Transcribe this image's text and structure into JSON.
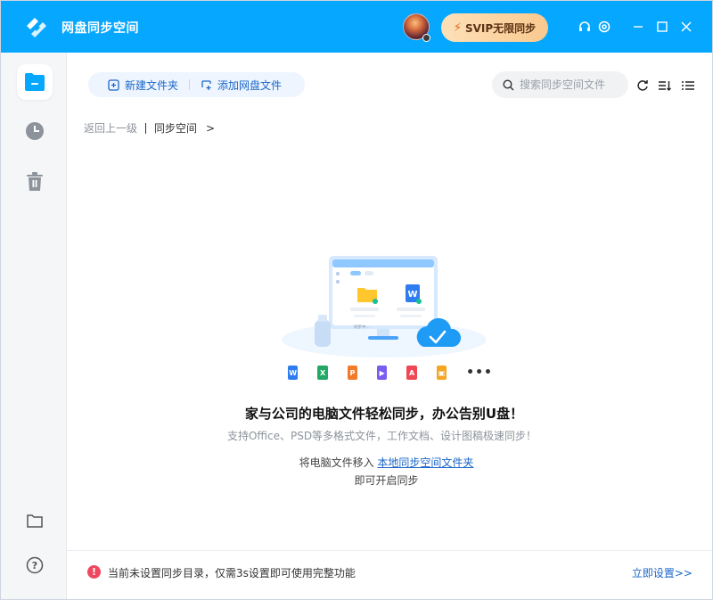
{
  "app": {
    "title": "网盘同步空间"
  },
  "header": {
    "svip_label": "SVIP无限同步"
  },
  "toolbar": {
    "new_folder": "新建文件夹",
    "add_cloud_file": "添加网盘文件",
    "search_placeholder": "搜索同步空间文件"
  },
  "breadcrumb": {
    "back": "返回上一级",
    "current": "同步空间",
    "chevron": ">"
  },
  "empty_state": {
    "illustration_caption": "同步中...",
    "file_types": [
      {
        "name": "word-icon",
        "color": "#2f7cf0",
        "letter": "W"
      },
      {
        "name": "excel-icon",
        "color": "#23a866",
        "letter": "X"
      },
      {
        "name": "ppt-icon",
        "color": "#f27b2b",
        "letter": "P"
      },
      {
        "name": "video-icon",
        "color": "#7a5cf0",
        "letter": "▶"
      },
      {
        "name": "pdf-icon",
        "color": "#ef4754",
        "letter": "A"
      },
      {
        "name": "image-icon",
        "color": "#f5a623",
        "letter": "▣"
      }
    ],
    "more": "•••",
    "headline": "家与公司的电脑文件轻松同步，办公告别U盘！",
    "subline": "支持Office、PSD等多格式文件，工作文档、设计图稿极速同步！",
    "hint_prefix": "将电脑文件移入 ",
    "hint_link": "本地同步空间文件夹",
    "hint_suffix": "即可开启同步"
  },
  "bottom_bar": {
    "warning_icon": "!",
    "message": "当前未设置同步目录，仅需3s设置即可使用完整功能",
    "action": "立即设置>>"
  },
  "colors": {
    "brand": "#06a7ff",
    "link": "#1a66c9",
    "warning": "#f0475f"
  }
}
